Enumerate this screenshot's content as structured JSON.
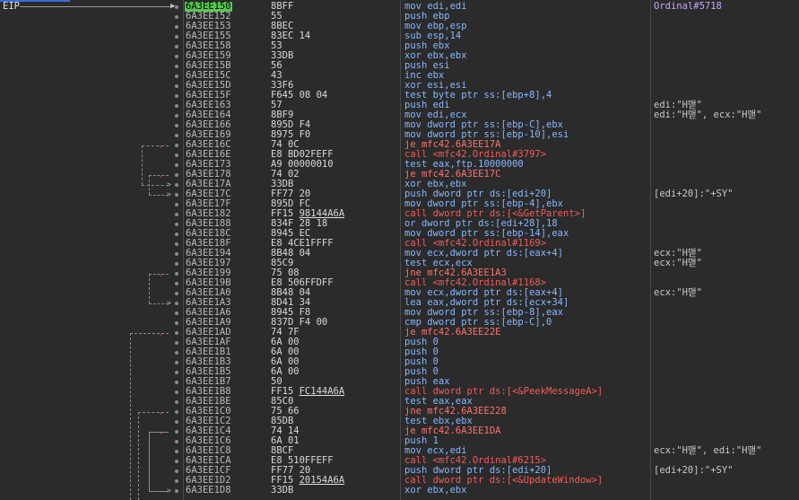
{
  "eip_label": "EIP",
  "colors": {
    "current_addr_bg": "#55c84c",
    "call": "#f25b5b",
    "jump": "#ff7070",
    "push": "#86b7ff",
    "ordinal_comment": "#c8a4ff"
  },
  "rows": [
    {
      "addr": "6A3EE150",
      "bytes": "8BFF",
      "mn": "mov",
      "ops": "edi,edi",
      "comment": "Ordinal#5718",
      "current": true
    },
    {
      "addr": "6A3EE152",
      "bytes": "55",
      "mn": "push",
      "ops": "ebp",
      "comment": ""
    },
    {
      "addr": "6A3EE153",
      "bytes": "8BEC",
      "mn": "mov",
      "ops": "ebp,esp",
      "comment": ""
    },
    {
      "addr": "6A3EE155",
      "bytes": "83EC 14",
      "mn": "sub",
      "ops": "esp,14",
      "comment": ""
    },
    {
      "addr": "6A3EE158",
      "bytes": "53",
      "mn": "push",
      "ops": "ebx",
      "comment": ""
    },
    {
      "addr": "6A3EE159",
      "bytes": "33DB",
      "mn": "xor",
      "ops": "ebx,ebx",
      "comment": ""
    },
    {
      "addr": "6A3EE15B",
      "bytes": "56",
      "mn": "push",
      "ops": "esi",
      "comment": ""
    },
    {
      "addr": "6A3EE15C",
      "bytes": "43",
      "mn": "inc",
      "ops": "ebx",
      "comment": ""
    },
    {
      "addr": "6A3EE15D",
      "bytes": "33F6",
      "mn": "xor",
      "ops": "esi,esi",
      "comment": ""
    },
    {
      "addr": "6A3EE15F",
      "bytes": "F645 08 04",
      "mn": "test",
      "ops": "byte ptr ss:[ebp+8],4",
      "comment": ""
    },
    {
      "addr": "6A3EE163",
      "bytes": "57",
      "mn": "push",
      "ops": "edi",
      "comment": "edi:\"H맫\""
    },
    {
      "addr": "6A3EE164",
      "bytes": "8BF9",
      "mn": "mov",
      "ops": "edi,ecx",
      "comment": "edi:\"H맫\", ecx:\"H맫\""
    },
    {
      "addr": "6A3EE166",
      "bytes": "895D F4",
      "mn": "mov",
      "ops": "dword ptr ss:[ebp-C],ebx",
      "comment": ""
    },
    {
      "addr": "6A3EE169",
      "bytes": "8975 F0",
      "mn": "mov",
      "ops": "dword ptr ss:[ebp-10],esi",
      "comment": ""
    },
    {
      "addr": "6A3EE16C",
      "bytes": "74 0C",
      "mn": "je",
      "ops": "mfc42.6A3EE17A",
      "comment": "",
      "jmark": true
    },
    {
      "addr": "6A3EE16E",
      "bytes": "E8 BD02FEFF",
      "mn": "call",
      "ops": "<mfc42.Ordinal#3797>",
      "comment": ""
    },
    {
      "addr": "6A3EE173",
      "bytes": "A9 00000010",
      "mn": "test",
      "ops": "eax,ftp.10000000",
      "comment": ""
    },
    {
      "addr": "6A3EE178",
      "bytes": "74 02",
      "mn": "je",
      "ops": "mfc42.6A3EE17C",
      "comment": "",
      "jmark": true
    },
    {
      "addr": "6A3EE17A",
      "bytes": "33DB",
      "mn": "xor",
      "ops": "ebx,ebx",
      "comment": ""
    },
    {
      "addr": "6A3EE17C",
      "bytes": "FF77 20",
      "mn": "push",
      "ops": "dword ptr ds:[edi+20]",
      "comment": "[edi+20]:\"+SY\""
    },
    {
      "addr": "6A3EE17F",
      "bytes": "895D FC",
      "mn": "mov",
      "ops": "dword ptr ss:[ebp-4],ebx",
      "comment": ""
    },
    {
      "addr": "6A3EE182",
      "bytes": "FF15 98144A6A",
      "mn": "call",
      "ops": "dword ptr ds:[<&GetParent>]",
      "comment": "",
      "ul": "98144A6A"
    },
    {
      "addr": "6A3EE188",
      "bytes": "834F 28 18",
      "mn": "or",
      "ops": "dword ptr ds:[edi+28],18",
      "comment": ""
    },
    {
      "addr": "6A3EE18C",
      "bytes": "8945 EC",
      "mn": "mov",
      "ops": "dword ptr ss:[ebp-14],eax",
      "comment": ""
    },
    {
      "addr": "6A3EE18F",
      "bytes": "E8 4CE1FFFF",
      "mn": "call",
      "ops": "<mfc42.Ordinal#1169>",
      "comment": ""
    },
    {
      "addr": "6A3EE194",
      "bytes": "8B48 04",
      "mn": "mov",
      "ops": "ecx,dword ptr ds:[eax+4]",
      "comment": "ecx:\"H맫\""
    },
    {
      "addr": "6A3EE197",
      "bytes": "85C9",
      "mn": "test",
      "ops": "ecx,ecx",
      "comment": "ecx:\"H맫\""
    },
    {
      "addr": "6A3EE199",
      "bytes": "75 08",
      "mn": "jne",
      "ops": "mfc42.6A3EE1A3",
      "comment": "",
      "jmark": true
    },
    {
      "addr": "6A3EE19B",
      "bytes": "E8 506FFDFF",
      "mn": "call",
      "ops": "<mfc42.Ordinal#1168>",
      "comment": ""
    },
    {
      "addr": "6A3EE1A0",
      "bytes": "8B48 04",
      "mn": "mov",
      "ops": "ecx,dword ptr ds:[eax+4]",
      "comment": "ecx:\"H맫\""
    },
    {
      "addr": "6A3EE1A3",
      "bytes": "8D41 34",
      "mn": "lea",
      "ops": "eax,dword ptr ds:[ecx+34]",
      "comment": ""
    },
    {
      "addr": "6A3EE1A6",
      "bytes": "8945 F8",
      "mn": "mov",
      "ops": "dword ptr ss:[ebp-8],eax",
      "comment": ""
    },
    {
      "addr": "6A3EE1A9",
      "bytes": "837D F4 00",
      "mn": "cmp",
      "ops": "dword ptr ss:[ebp-C],0",
      "comment": ""
    },
    {
      "addr": "6A3EE1AD",
      "bytes": "74 7F",
      "mn": "je",
      "ops": "mfc42.6A3EE22E",
      "comment": "",
      "jmark": true
    },
    {
      "addr": "6A3EE1AF",
      "bytes": "6A 00",
      "mn": "push",
      "ops": "0",
      "comment": ""
    },
    {
      "addr": "6A3EE1B1",
      "bytes": "6A 00",
      "mn": "push",
      "ops": "0",
      "comment": ""
    },
    {
      "addr": "6A3EE1B3",
      "bytes": "6A 00",
      "mn": "push",
      "ops": "0",
      "comment": ""
    },
    {
      "addr": "6A3EE1B5",
      "bytes": "6A 00",
      "mn": "push",
      "ops": "0",
      "comment": ""
    },
    {
      "addr": "6A3EE1B7",
      "bytes": "50",
      "mn": "push",
      "ops": "eax",
      "comment": ""
    },
    {
      "addr": "6A3EE1B8",
      "bytes": "FF15 FC144A6A",
      "mn": "call",
      "ops": "dword ptr ds:[<&PeekMessageA>]",
      "comment": "",
      "ul": "FC144A6A"
    },
    {
      "addr": "6A3EE1BE",
      "bytes": "85C0",
      "mn": "test",
      "ops": "eax,eax",
      "comment": ""
    },
    {
      "addr": "6A3EE1C0",
      "bytes": "75 66",
      "mn": "jne",
      "ops": "mfc42.6A3EE228",
      "comment": "",
      "jmark": true
    },
    {
      "addr": "6A3EE1C2",
      "bytes": "85DB",
      "mn": "test",
      "ops": "ebx,ebx",
      "comment": ""
    },
    {
      "addr": "6A3EE1C4",
      "bytes": "74 14",
      "mn": "je",
      "ops": "mfc42.6A3EE1DA",
      "comment": "",
      "jmark": true
    },
    {
      "addr": "6A3EE1C6",
      "bytes": "6A 01",
      "mn": "push",
      "ops": "1",
      "comment": ""
    },
    {
      "addr": "6A3EE1C8",
      "bytes": "8BCF",
      "mn": "mov",
      "ops": "ecx,edi",
      "comment": "ecx:\"H맫\", edi:\"H맫\""
    },
    {
      "addr": "6A3EE1CA",
      "bytes": "E8 510FFEFF",
      "mn": "call",
      "ops": "<mfc42.Ordinal#6215>",
      "comment": ""
    },
    {
      "addr": "6A3EE1CF",
      "bytes": "FF77 20",
      "mn": "push",
      "ops": "dword ptr ds:[edi+20]",
      "comment": "[edi+20]:\"+SY\""
    },
    {
      "addr": "6A3EE1D2",
      "bytes": "FF15 20154A6A",
      "mn": "call",
      "ops": "dword ptr ds:[<&UpdateWindow>]",
      "comment": "",
      "ul": "20154A6A"
    },
    {
      "addr": "6A3EE1D8",
      "bytes": "33DB",
      "mn": "xor",
      "ops": "ebx,ebx",
      "comment": ""
    }
  ]
}
